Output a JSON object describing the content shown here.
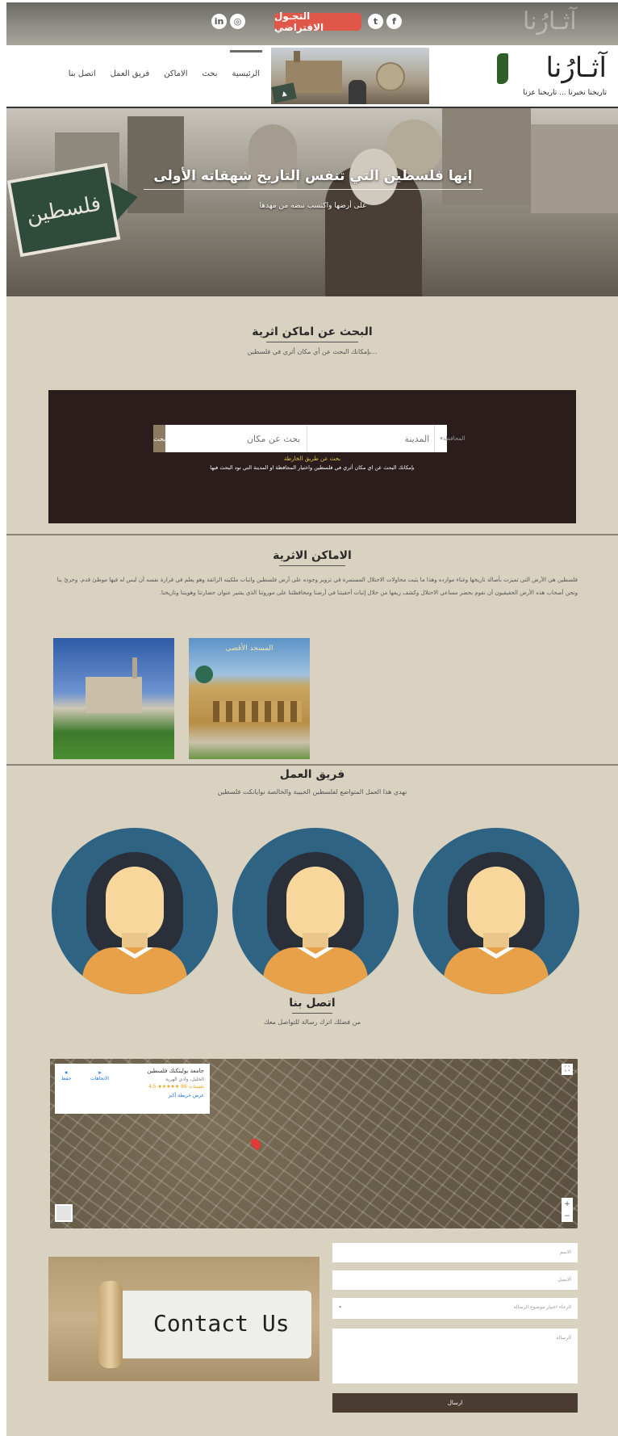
{
  "social": {
    "facebook_icon_glyph": "f",
    "twitter_icon_glyph": "t",
    "instagram_icon_glyph": "◎",
    "linkedin_icon_glyph": "in",
    "virtual_tour_label": "التجـول الافتراضي"
  },
  "nav": {
    "items": [
      "الرئيسية",
      "بحث",
      "الاماكن",
      "فريق العمل",
      "اتصل بنا"
    ]
  },
  "logo": {
    "title": "آثـارُنا",
    "tagline": "تاريخنا نخبرنا ... تاريخنا عزنا"
  },
  "hero": {
    "sign_text": "فلسطين",
    "title": "إنها فلسطين التي تنفس التاريخ شهقاته الأولى",
    "subtitle": "على أرضها واكتسب نبضه من مهدها"
  },
  "search_section": {
    "title": "البحث عن اماكن اثرية",
    "subtitle": "بإمكانك البحث عن أي مكان أثري في فلسطين...",
    "search_button": "بحث",
    "place_placeholder": "بحث عن مكان",
    "city_placeholder": "المدينة",
    "governorate_select": "المحافظة",
    "map_search_link": "بحث عن طريق الخارطة",
    "note": "بإمكانك البحث عن اي مكان أثري في فلسطين واختيار المحافظة او المدينة التي تود البحث فيها"
  },
  "places_section": {
    "title": "الاماكن الاثرية",
    "description": "فلسطين هي الأرض التي تميزت بأصالة تاريخها وغناء موارده وهذا ما يثبت محاولات الاحتلال المستمرة في تزوير وجوده على أرض فلسطين واثبات ملكيته الزائفة وهو يعلم في قرارة نفسه أن ليس له فيها موطئ قدم. وحريٌ بنا ونحن أصحاب هذه الأرض الحقيقيون أن نقوم بحضر مساعي الاحتلال وكشف زيفها من خلال إثبات أحقيتنا في أرضنا ومحافظتنا على موروثنا الذي يشير عنوان حضارتنا وهويتنا وتاريخنا.",
    "aqsa_caption": "المسجد الأقصى"
  },
  "team_section": {
    "title": "فريق العمل",
    "subtitle": "نهدي هذا العمل المتواضع لفلسطين الحبيبة والخالصة نوايانكت فلسطين"
  },
  "contact_section": {
    "title": "اتصل بنا",
    "subtitle": "من فضلك اترك رسالة للتواصل معك",
    "map_card": {
      "name": "جامعة بوليتكنك فلسطين",
      "address": "الخليل، وادي الهرية",
      "rating": "4.5 ★★★★★ 86 تقييمات",
      "more_link": "عرض خريطة أكبر",
      "directions": "الاتجاهات",
      "save": "حفظ"
    },
    "contact_image_text": "Contact Us",
    "name_placeholder": "الاسم",
    "email_placeholder": "الايميل",
    "subject_select": "الرجاء اختيار موضوع الرسالة",
    "message_placeholder": "الرسالة",
    "submit_label": "ارسال"
  },
  "colors": {
    "page_bg": "#d9d2c0",
    "tour_button": "#e0574a",
    "search_panel": "#2b1d1c",
    "map_link": "#e7c84d",
    "submit_button": "#4a3c30",
    "avatar_bg": "#2e6384"
  }
}
